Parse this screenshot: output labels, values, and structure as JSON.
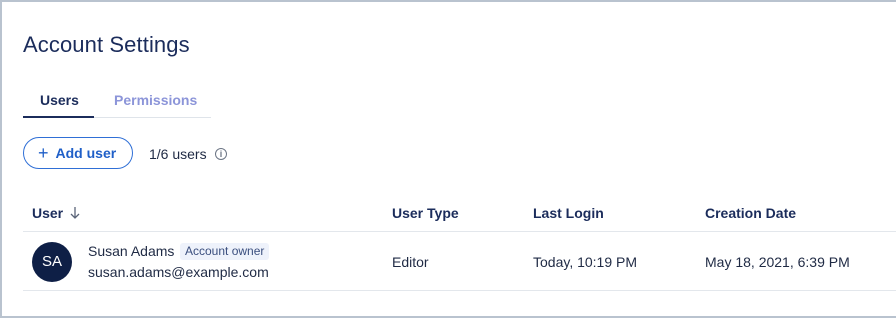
{
  "page": {
    "title": "Account Settings"
  },
  "tabs": [
    {
      "label": "Users",
      "active": true
    },
    {
      "label": "Permissions",
      "active": false
    }
  ],
  "toolbar": {
    "add_user_label": "Add user",
    "add_user_icon": "plus-icon",
    "user_count": "1/6 users",
    "info_icon": "info-icon"
  },
  "table": {
    "columns": [
      "User",
      "User Type",
      "Last Login",
      "Creation Date"
    ],
    "sort_icon": "arrow-down-icon",
    "rows": [
      {
        "initials": "SA",
        "name": "Susan Adams",
        "badge": "Account owner",
        "email": "susan.adams@example.com",
        "user_type": "Editor",
        "last_login": "Today, 10:19 PM",
        "creation_date": "May 18, 2021, 6:39 PM"
      }
    ]
  },
  "colors": {
    "accent": "#2f6fd6",
    "title": "#1b2c5b",
    "avatar_bg": "#0e1f46",
    "inactive_tab": "#8c95d9"
  }
}
